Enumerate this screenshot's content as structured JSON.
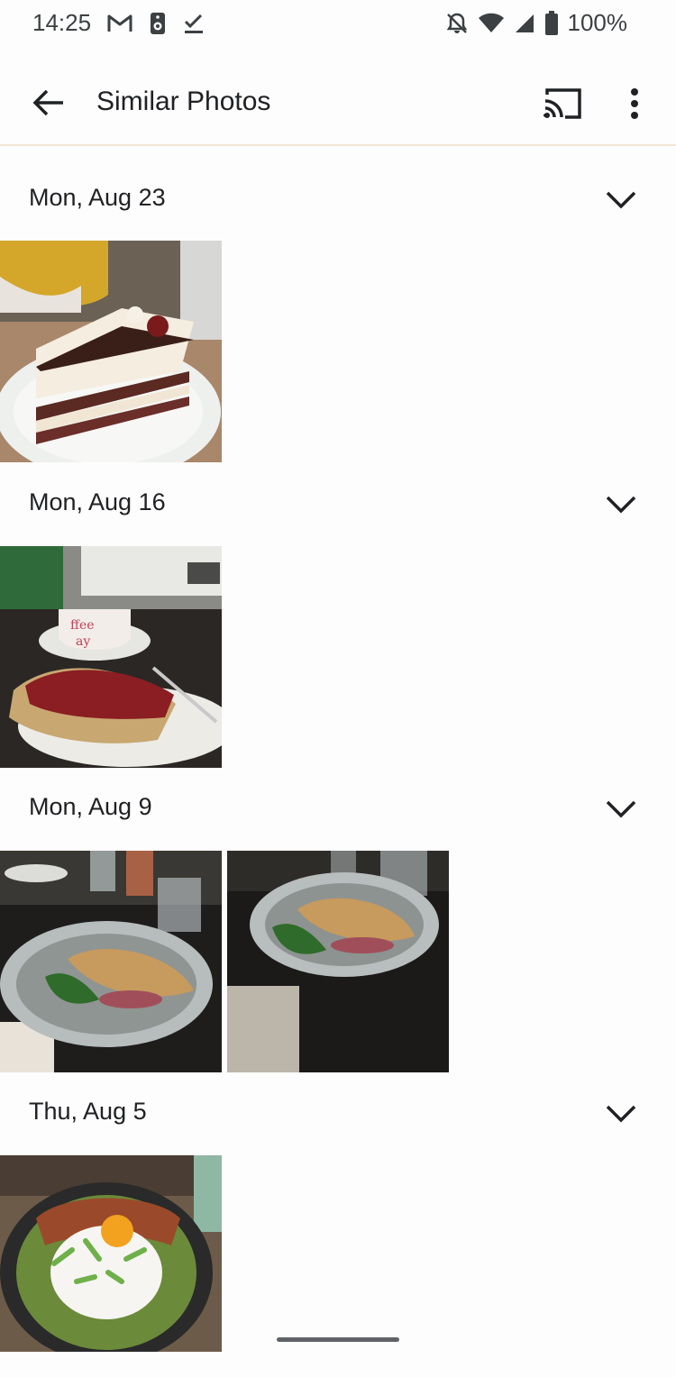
{
  "status_bar": {
    "time": "14:25",
    "battery": "100%",
    "icons": [
      "gmail-icon",
      "speaker-icon",
      "task-done-icon",
      "notifications-off-icon",
      "wifi-icon",
      "signal-icon",
      "battery-icon"
    ]
  },
  "app_bar": {
    "title": "Similar Photos",
    "icons": [
      "back-arrow-icon",
      "cast-icon",
      "more-vert-icon"
    ]
  },
  "sections": [
    {
      "date": "Mon, Aug 23",
      "photos": [
        "cake-photo"
      ]
    },
    {
      "date": "Mon, Aug 16",
      "photos": [
        "plum-cake-coffee-photo"
      ]
    },
    {
      "date": "Mon, Aug 9",
      "photos": [
        "fish-plate-photo-1",
        "fish-plate-photo-2"
      ]
    },
    {
      "date": "Thu, Aug 5",
      "photos": [
        "egg-bowl-photo"
      ]
    }
  ],
  "colors": {
    "background": "#fdfdfd",
    "divider": "#f4e6d3",
    "text": "#202124"
  }
}
